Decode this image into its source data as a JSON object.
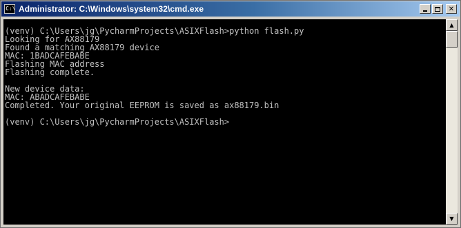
{
  "window": {
    "title": "Administrator: C:\\Windows\\system32\\cmd.exe",
    "icon_name": "cmd-icon",
    "icon_text": "C:\\"
  },
  "controls": {
    "minimize_icon": "minimize-icon",
    "maximize_icon": "maximize-icon",
    "close_icon": "close-icon",
    "close_glyph": "✕"
  },
  "console": {
    "lines": [
      "(venv) C:\\Users\\jg\\PycharmProjects\\ASIXFlash>python flash.py",
      "Looking for AX88179",
      "Found a matching AX88179 device",
      "MAC: 1BADCAFEBABE",
      "Flashing MAC address",
      "Flashing complete.",
      "",
      "New device data:",
      "MAC: ABADCAFEBABE",
      "Completed. Your original EEPROM is saved as ax88179.bin",
      "",
      "(venv) C:\\Users\\jg\\PycharmProjects\\ASIXFlash>"
    ]
  },
  "scrollbar": {
    "up_icon": "scroll-up-arrow-icon",
    "down_icon": "scroll-down-arrow-icon",
    "up_glyph": "▲",
    "down_glyph": "▼"
  }
}
